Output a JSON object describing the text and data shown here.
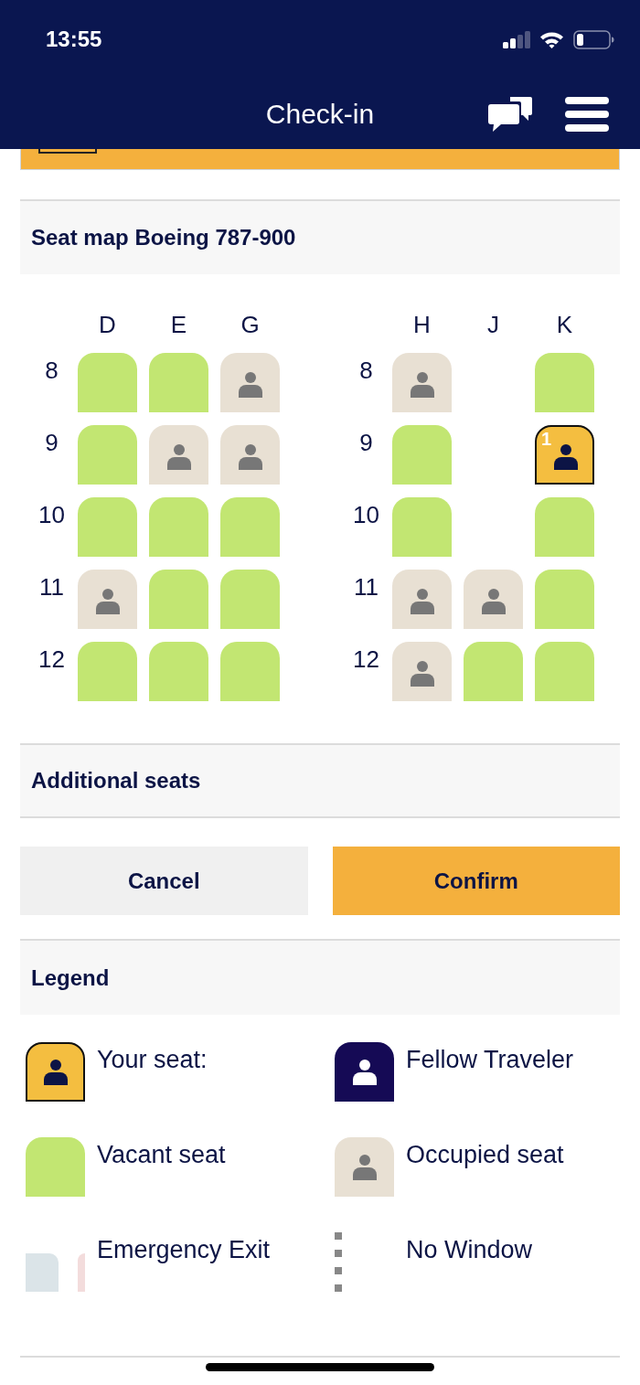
{
  "status_bar": {
    "time": "13:55"
  },
  "header": {
    "title": "Check-in"
  },
  "seat_map": {
    "title": "Seat map Boeing 787-900",
    "blocks": [
      {
        "columns": [
          "D",
          "E",
          "G"
        ],
        "rows": [
          {
            "number": "8",
            "seats": [
              {
                "kind": "vacant",
                "selected": false
              },
              {
                "kind": "vacant",
                "selected": false
              },
              {
                "kind": "occupied",
                "selected": false
              }
            ]
          },
          {
            "number": "9",
            "seats": [
              {
                "kind": "vacant",
                "selected": false
              },
              {
                "kind": "occupied",
                "selected": false
              },
              {
                "kind": "occupied",
                "selected": false
              }
            ]
          },
          {
            "number": "10",
            "seats": [
              {
                "kind": "vacant",
                "selected": false
              },
              {
                "kind": "vacant",
                "selected": false
              },
              {
                "kind": "vacant",
                "selected": false
              }
            ]
          },
          {
            "number": "11",
            "seats": [
              {
                "kind": "occupied",
                "selected": false
              },
              {
                "kind": "vacant",
                "selected": false
              },
              {
                "kind": "vacant",
                "selected": false
              }
            ]
          },
          {
            "number": "12",
            "seats": [
              {
                "kind": "vacant",
                "selected": false
              },
              {
                "kind": "vacant",
                "selected": false
              },
              {
                "kind": "vacant",
                "selected": false
              }
            ]
          }
        ]
      },
      {
        "columns": [
          "H",
          "J",
          "K"
        ],
        "rows": [
          {
            "number": "8",
            "seats": [
              {
                "kind": "occupied",
                "selected": false
              },
              {
                "kind": "empty"
              },
              {
                "kind": "vacant",
                "selected": false
              }
            ]
          },
          {
            "number": "9",
            "seats": [
              {
                "kind": "vacant",
                "selected": false
              },
              {
                "kind": "empty"
              },
              {
                "kind": "occupied",
                "selected": true,
                "label": "1"
              }
            ]
          },
          {
            "number": "10",
            "seats": [
              {
                "kind": "vacant",
                "selected": false
              },
              {
                "kind": "empty"
              },
              {
                "kind": "vacant",
                "selected": false
              }
            ]
          },
          {
            "number": "11",
            "seats": [
              {
                "kind": "occupied",
                "selected": false
              },
              {
                "kind": "occupied",
                "selected": false
              },
              {
                "kind": "vacant",
                "selected": false
              }
            ]
          },
          {
            "number": "12",
            "seats": [
              {
                "kind": "occupied",
                "selected": false
              },
              {
                "kind": "vacant",
                "selected": false
              },
              {
                "kind": "vacant",
                "selected": false
              }
            ]
          }
        ]
      }
    ]
  },
  "additional_seats": {
    "title": "Additional seats"
  },
  "buttons": [
    {
      "label": "Cancel",
      "kind": "secondary"
    },
    {
      "label": "Confirm",
      "kind": "primary"
    }
  ],
  "legend": {
    "title": "Legend",
    "items": [
      {
        "kind": "yours",
        "label": "Your seat:"
      },
      {
        "kind": "fellow",
        "label": "Fellow Traveler"
      },
      {
        "kind": "vacant",
        "label": "Vacant seat"
      },
      {
        "kind": "occupied",
        "label": "Occupied seat"
      },
      {
        "kind": "exit",
        "label": "Emergency Exit"
      },
      {
        "kind": "no_window",
        "label": "No Window"
      }
    ]
  }
}
